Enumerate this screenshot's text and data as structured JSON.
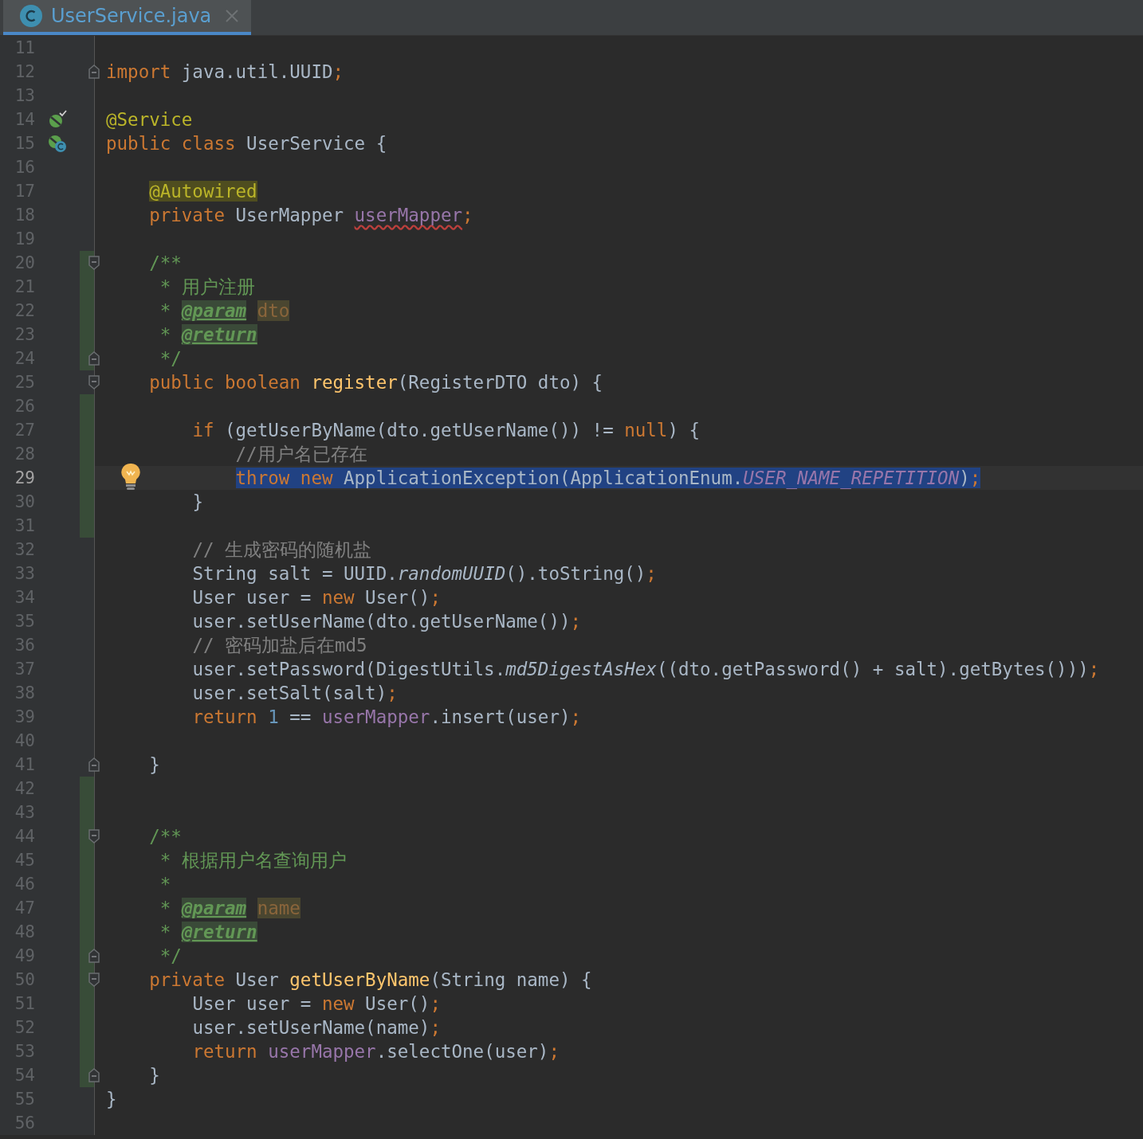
{
  "tab": {
    "title": "UserService.java",
    "selected": true
  },
  "lines": [
    {
      "number": "11",
      "changed": false,
      "selected": false
    },
    {
      "number": "12",
      "changed": false,
      "selected": false,
      "fold": {
        "kind": "end"
      },
      "tokens": [
        {
          "kind": "keyword",
          "text": "import"
        },
        {
          "kind": "plain",
          "text": " java.util.UUID"
        },
        {
          "kind": "keyword",
          "text": ";"
        }
      ]
    },
    {
      "number": "13",
      "changed": false,
      "selected": false
    },
    {
      "number": "14",
      "changed": false,
      "selected": false,
      "gutter_marker": {
        "kind": "bean-check"
      },
      "tokens": [
        {
          "kind": "annotation",
          "text": "@Service"
        }
      ]
    },
    {
      "number": "15",
      "changed": false,
      "selected": false,
      "gutter_marker": {
        "kind": "bean-class"
      },
      "tokens": [
        {
          "kind": "keyword",
          "text": "public class"
        },
        {
          "kind": "plain",
          "text": " UserService {"
        }
      ]
    },
    {
      "number": "16",
      "changed": false,
      "selected": false
    },
    {
      "number": "17",
      "changed": false,
      "selected": false,
      "tokens": [
        {
          "kind": "annotation-marked",
          "text": "    @Autowired"
        }
      ]
    },
    {
      "number": "18",
      "changed": false,
      "selected": false,
      "tokens": [
        {
          "kind": "keyword",
          "text": "    private"
        },
        {
          "kind": "plain",
          "text": " UserMapper "
        },
        {
          "kind": "field-typo",
          "text": "userMapper"
        },
        {
          "kind": "keyword",
          "text": ";"
        }
      ]
    },
    {
      "number": "19",
      "changed": false,
      "selected": false
    },
    {
      "number": "20",
      "changed": true,
      "selected": false,
      "fold": {
        "kind": "start"
      },
      "tokens": [
        {
          "kind": "doc",
          "text": "    /**"
        }
      ]
    },
    {
      "number": "21",
      "changed": true,
      "selected": false,
      "tokens": [
        {
          "kind": "doc",
          "text": "     * 用户注册"
        }
      ]
    },
    {
      "number": "22",
      "changed": true,
      "selected": false,
      "tokens": [
        {
          "kind": "doc",
          "text": "     * "
        },
        {
          "kind": "doc-tag",
          "text": "@param "
        },
        {
          "kind": "doc-param",
          "text": "dto"
        }
      ]
    },
    {
      "number": "23",
      "changed": true,
      "selected": false,
      "tokens": [
        {
          "kind": "doc",
          "text": "     * "
        },
        {
          "kind": "doc-tag",
          "text": "@return"
        }
      ]
    },
    {
      "number": "24",
      "changed": true,
      "selected": false,
      "fold": {
        "kind": "end"
      },
      "tokens": [
        {
          "kind": "doc",
          "text": "     */"
        }
      ]
    },
    {
      "number": "25",
      "changed": false,
      "selected": false,
      "fold": {
        "kind": "start"
      },
      "tokens": [
        {
          "kind": "keyword",
          "text": "    public boolean "
        },
        {
          "kind": "method-decl",
          "text": "register"
        },
        {
          "kind": "plain",
          "text": "(RegisterDTO dto) {"
        }
      ]
    },
    {
      "number": "26",
      "changed": true,
      "selected": false
    },
    {
      "number": "27",
      "changed": true,
      "selected": false,
      "tokens": [
        {
          "kind": "keyword",
          "text": "        if"
        },
        {
          "kind": "plain",
          "text": " (getUserByName(dto.getUserName()) != "
        },
        {
          "kind": "keyword",
          "text": "null"
        },
        {
          "kind": "plain",
          "text": ") {"
        }
      ]
    },
    {
      "number": "28",
      "changed": true,
      "selected": false,
      "tokens": [
        {
          "kind": "comment",
          "text": "            //用户名已存在"
        }
      ]
    },
    {
      "number": "29",
      "changed": true,
      "selected": true,
      "intention": true,
      "tokens": [
        {
          "kind": "keyword",
          "text": "            throw new"
        },
        {
          "kind": "plain",
          "text": " ApplicationException(ApplicationEnum."
        },
        {
          "kind": "constant",
          "text": "USER_NAME_REPETITION"
        },
        {
          "kind": "plain",
          "text": ")"
        },
        {
          "kind": "keyword",
          "text": ";"
        }
      ]
    },
    {
      "number": "30",
      "changed": true,
      "selected": false,
      "tokens": [
        {
          "kind": "plain",
          "text": "        }"
        }
      ]
    },
    {
      "number": "31",
      "changed": true,
      "selected": false
    },
    {
      "number": "32",
      "changed": false,
      "selected": false,
      "tokens": [
        {
          "kind": "comment",
          "text": "        // 生成密码的随机盐"
        }
      ]
    },
    {
      "number": "33",
      "changed": false,
      "selected": false,
      "tokens": [
        {
          "kind": "plain",
          "text": "        String salt = UUID."
        },
        {
          "kind": "static-method",
          "text": "randomUUID"
        },
        {
          "kind": "plain",
          "text": "().toString()"
        },
        {
          "kind": "keyword",
          "text": ";"
        }
      ]
    },
    {
      "number": "34",
      "changed": false,
      "selected": false,
      "tokens": [
        {
          "kind": "plain",
          "text": "        User user = "
        },
        {
          "kind": "keyword",
          "text": "new"
        },
        {
          "kind": "plain",
          "text": " User()"
        },
        {
          "kind": "keyword",
          "text": ";"
        }
      ]
    },
    {
      "number": "35",
      "changed": false,
      "selected": false,
      "tokens": [
        {
          "kind": "plain",
          "text": "        user.setUserName(dto.getUserName())"
        },
        {
          "kind": "keyword",
          "text": ";"
        }
      ]
    },
    {
      "number": "36",
      "changed": false,
      "selected": false,
      "tokens": [
        {
          "kind": "comment",
          "text": "        // 密码加盐后在md5"
        }
      ]
    },
    {
      "number": "37",
      "changed": false,
      "selected": false,
      "tokens": [
        {
          "kind": "plain",
          "text": "        user.setPassword(DigestUtils."
        },
        {
          "kind": "static-method",
          "text": "md5DigestAsHex"
        },
        {
          "kind": "plain",
          "text": "((dto.getPassword() + salt).getBytes()))"
        },
        {
          "kind": "keyword",
          "text": ";"
        }
      ]
    },
    {
      "number": "38",
      "changed": false,
      "selected": false,
      "tokens": [
        {
          "kind": "plain",
          "text": "        user.setSalt(salt)"
        },
        {
          "kind": "keyword",
          "text": ";"
        }
      ]
    },
    {
      "number": "39",
      "changed": false,
      "selected": false,
      "tokens": [
        {
          "kind": "keyword",
          "text": "        return "
        },
        {
          "kind": "number",
          "text": "1"
        },
        {
          "kind": "plain",
          "text": " == "
        },
        {
          "kind": "field",
          "text": "userMapper"
        },
        {
          "kind": "plain",
          "text": ".insert(user)"
        },
        {
          "kind": "keyword",
          "text": ";"
        }
      ]
    },
    {
      "number": "40",
      "changed": false,
      "selected": false
    },
    {
      "number": "41",
      "changed": false,
      "selected": false,
      "fold": {
        "kind": "end"
      },
      "tokens": [
        {
          "kind": "plain",
          "text": "    }"
        }
      ]
    },
    {
      "number": "42",
      "changed": true,
      "selected": false
    },
    {
      "number": "43",
      "changed": true,
      "selected": false
    },
    {
      "number": "44",
      "changed": true,
      "selected": false,
      "fold": {
        "kind": "start"
      },
      "tokens": [
        {
          "kind": "doc",
          "text": "    /**"
        }
      ]
    },
    {
      "number": "45",
      "changed": true,
      "selected": false,
      "tokens": [
        {
          "kind": "doc",
          "text": "     * 根据用户名查询用户"
        }
      ]
    },
    {
      "number": "46",
      "changed": true,
      "selected": false,
      "tokens": [
        {
          "kind": "doc",
          "text": "     *"
        }
      ]
    },
    {
      "number": "47",
      "changed": true,
      "selected": false,
      "tokens": [
        {
          "kind": "doc",
          "text": "     * "
        },
        {
          "kind": "doc-tag",
          "text": "@param "
        },
        {
          "kind": "doc-param",
          "text": "name"
        }
      ]
    },
    {
      "number": "48",
      "changed": true,
      "selected": false,
      "tokens": [
        {
          "kind": "doc",
          "text": "     * "
        },
        {
          "kind": "doc-tag",
          "text": "@return"
        }
      ]
    },
    {
      "number": "49",
      "changed": true,
      "selected": false,
      "fold": {
        "kind": "end"
      },
      "tokens": [
        {
          "kind": "doc",
          "text": "     */"
        }
      ]
    },
    {
      "number": "50",
      "changed": true,
      "selected": false,
      "fold": {
        "kind": "start"
      },
      "tokens": [
        {
          "kind": "keyword",
          "text": "    private"
        },
        {
          "kind": "plain",
          "text": " User "
        },
        {
          "kind": "method-decl",
          "text": "getUserByName"
        },
        {
          "kind": "plain",
          "text": "(String name) {"
        }
      ]
    },
    {
      "number": "51",
      "changed": true,
      "selected": false,
      "tokens": [
        {
          "kind": "plain",
          "text": "        User user = "
        },
        {
          "kind": "keyword",
          "text": "new"
        },
        {
          "kind": "plain",
          "text": " User()"
        },
        {
          "kind": "keyword",
          "text": ";"
        }
      ]
    },
    {
      "number": "52",
      "changed": true,
      "selected": false,
      "tokens": [
        {
          "kind": "plain",
          "text": "        user.setUserName(name)"
        },
        {
          "kind": "keyword",
          "text": ";"
        }
      ]
    },
    {
      "number": "53",
      "changed": true,
      "selected": false,
      "tokens": [
        {
          "kind": "keyword",
          "text": "        return "
        },
        {
          "kind": "field",
          "text": "userMapper"
        },
        {
          "kind": "plain",
          "text": ".selectOne(user)"
        },
        {
          "kind": "keyword",
          "text": ";"
        }
      ]
    },
    {
      "number": "54",
      "changed": true,
      "selected": false,
      "fold": {
        "kind": "end"
      },
      "tokens": [
        {
          "kind": "plain",
          "text": "    }"
        }
      ]
    },
    {
      "number": "55",
      "changed": false,
      "selected": false,
      "tokens": [
        {
          "kind": "plain",
          "text": "}"
        }
      ]
    },
    {
      "number": "56",
      "changed": false,
      "selected": false
    }
  ]
}
